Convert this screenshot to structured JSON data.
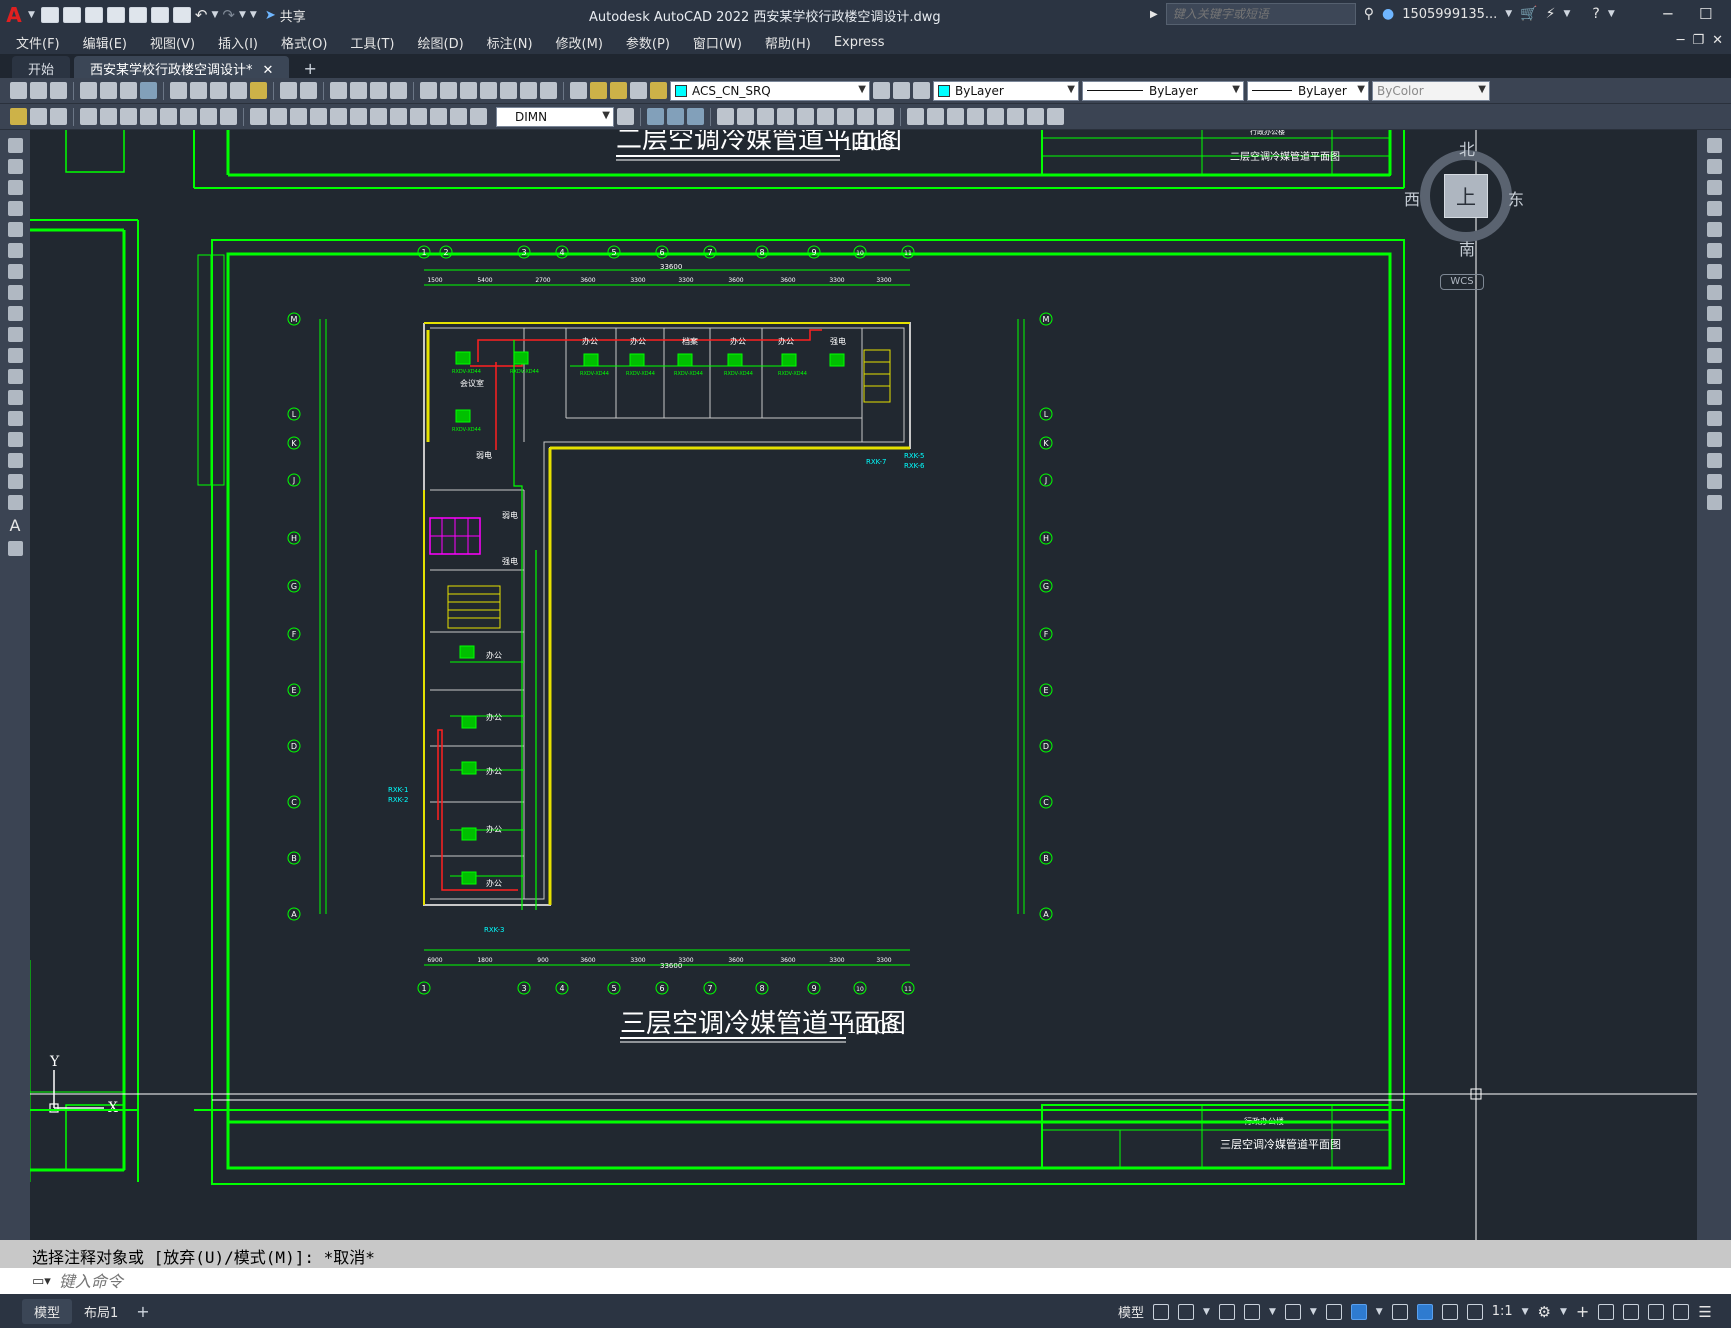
{
  "app": {
    "logo": "A",
    "title": "Autodesk AutoCAD 2022    西安某学校行政楼空调设计.dwg",
    "share_label": "共享",
    "search_placeholder": "键入关键字或短语",
    "user": "1505999135..."
  },
  "menu": [
    "文件(F)",
    "编辑(E)",
    "视图(V)",
    "插入(I)",
    "格式(O)",
    "工具(T)",
    "绘图(D)",
    "标注(N)",
    "修改(M)",
    "参数(P)",
    "窗口(W)",
    "帮助(H)",
    "Express"
  ],
  "tabs": [
    {
      "label": "开始"
    },
    {
      "label": "西安某学校行政楼空调设计*"
    }
  ],
  "toolbar": {
    "layer": "ACS_CN_SRQ",
    "color": "ByLayer",
    "linetype": "ByLayer",
    "lineweight": "ByLayer",
    "plotstyle": "ByColor",
    "dimstyle": "DIMN",
    "layer_color": "#00ffff"
  },
  "drawing": {
    "title_top": "二层空调冷媒管道平面图",
    "title_bottom": "三层空调冷媒管道平面图",
    "scale": "1:100",
    "titleblock_name_top": "二层空调冷媒管道平面图",
    "titleblock_name_bottom": "三层空调冷媒管道平面图",
    "titleblock_project": "行政办公楼",
    "grid_cols": [
      "1",
      "2",
      "3",
      "4",
      "5",
      "6",
      "7",
      "8",
      "9",
      "10",
      "11"
    ],
    "grid_rows": [
      "M",
      "L",
      "K",
      "J",
      "H",
      "G",
      "F",
      "E",
      "D",
      "C",
      "B",
      "A"
    ],
    "dims_top": [
      "1500",
      "5400",
      "2700",
      "3600",
      "3300",
      "3300",
      "3600",
      "3600",
      "3300",
      "3300"
    ],
    "dim_total": "33600",
    "dims_bottom": [
      "6900",
      "1800",
      "900",
      "3600",
      "3300",
      "3300",
      "3600",
      "3600",
      "3300",
      "3300"
    ],
    "room_labels": [
      "会议室",
      "办公",
      "办公",
      "办公",
      "档案",
      "办公",
      "办公",
      "弱电",
      "强电",
      "办公",
      "办公",
      "办公",
      "办公",
      "办公"
    ],
    "unit_tags": [
      "RXDV-XD44",
      "RXDV-XD44",
      "RXDV-XD44",
      "RXDV-XD44",
      "RXDV-XD44",
      "RXDV-XD44",
      "RXDV-XD44",
      "RXDV-XD44"
    ],
    "outdoor_tags": [
      "RXK-5",
      "RXK-6",
      "RXK-7",
      "RXK-1",
      "RXK-2",
      "RXK-3"
    ]
  },
  "viewcube": {
    "north": "北",
    "south": "南",
    "east": "东",
    "west": "西",
    "top": "上",
    "wcs": "WCS"
  },
  "command": {
    "history": "选择注释对象或 [放弃(U)/模式(M)]: *取消*",
    "placeholder": "键入命令"
  },
  "status": {
    "layout_tabs": [
      "模型",
      "布局1"
    ],
    "model_label": "模型",
    "scale": "1:1"
  }
}
